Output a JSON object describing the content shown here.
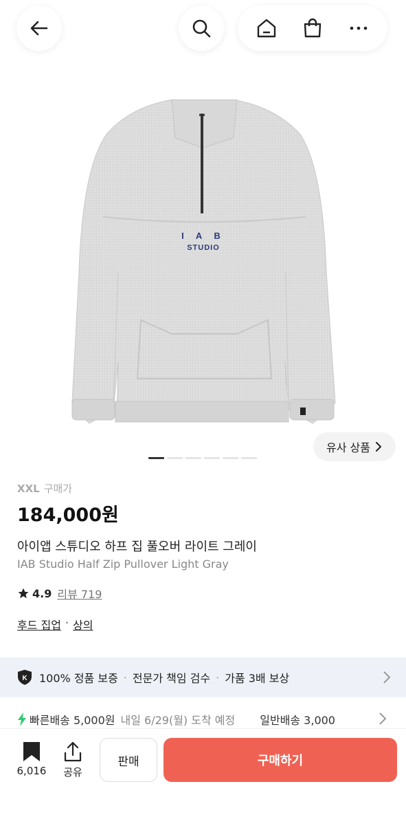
{
  "nav": {
    "back_icon": "arrow-left-icon",
    "search_icon": "search-icon",
    "home_icon": "home-icon",
    "bag_icon": "shopping-bag-icon",
    "more_icon": "more-horizontal-icon"
  },
  "gallery": {
    "similar_label": "유사 상품",
    "page_count": 6,
    "active_page": 1,
    "print_top": "I A B",
    "print_bottom": "STUDIO"
  },
  "product": {
    "size": "XXL",
    "price_label": "구매가",
    "price": "184,000원",
    "name_ko": "아이앱 스튜디오 하프 집 풀오버 라이트 그레이",
    "name_en": "IAB Studio Half Zip Pullover Light Gray",
    "rating": "4.9",
    "review_label": "리뷰 719",
    "category_1": "후드 집업",
    "category_sep": "·",
    "category_2": "상의"
  },
  "guarantee": {
    "item_1": "100% 정품 보증",
    "sep": "·",
    "item_2": "전문가 책임 검수",
    "item_3": "가품 3배 보상"
  },
  "shipping": {
    "fast": "빠른배송 5,000원",
    "eta": "내일 6/29(월) 도착 예정",
    "normal": "일반배송 3,000"
  },
  "bottom": {
    "bookmark_count": "6,016",
    "share_label": "공유",
    "sell_label": "판매",
    "buy_label": "구매하기"
  },
  "colors": {
    "accent": "#ef6253",
    "fast_ship": "#2ecc71",
    "guarantee_bg": "#eef2f8"
  }
}
